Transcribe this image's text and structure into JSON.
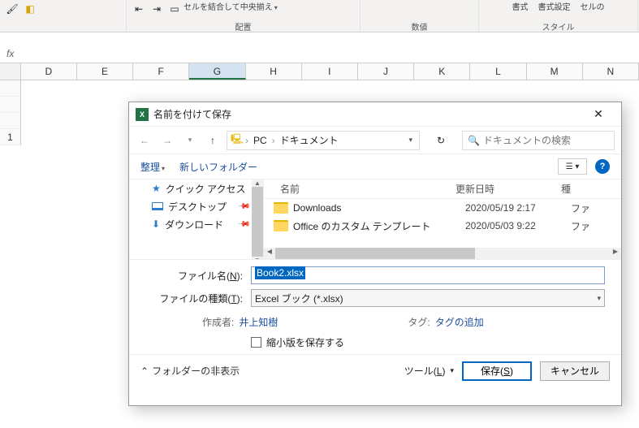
{
  "ribbon": {
    "merge_center": "セルを結合して中央揃え",
    "group_alignment": "配置",
    "group_number": "数値",
    "group_styles": "スタイル",
    "cond_fmt": "書式",
    "fmt_table": "書式設定",
    "cell_styles": "セルの"
  },
  "fx": {
    "label": "fx"
  },
  "columns": [
    "D",
    "E",
    "F",
    "G",
    "H",
    "I",
    "J",
    "K",
    "L",
    "M",
    "N"
  ],
  "rownum": "1",
  "dialog": {
    "title": "名前を付けて保存",
    "breadcrumb": {
      "root": "PC",
      "folder": "ドキュメント"
    },
    "search_placeholder": "ドキュメントの検索",
    "organize": "整理",
    "new_folder": "新しいフォルダー",
    "nav": {
      "quick_access": "クイック アクセス",
      "desktop": "デスクトップ",
      "downloads": "ダウンロード"
    },
    "list": {
      "col_name": "名前",
      "col_date": "更新日時",
      "col_type": "種",
      "rows": [
        {
          "name": "Downloads",
          "date": "2020/05/19 2:17",
          "type": "ファ"
        },
        {
          "name": "Office のカスタム テンプレート",
          "date": "2020/05/03 9:22",
          "type": "ファ"
        }
      ]
    },
    "filename_label": "ファイル名(N):",
    "filename_value": "Book2.xlsx",
    "filetype_label": "ファイルの種類(T):",
    "filetype_value": "Excel ブック (*.xlsx)",
    "author_label": "作成者:",
    "author_value": "井上知樹",
    "tags_label": "タグ:",
    "tags_value": "タグの追加",
    "thumbnail_label": "縮小版を保存する",
    "hide_folders": "フォルダーの非表示",
    "tools": "ツール(L)",
    "save": "保存(S)",
    "cancel": "キャンセル"
  }
}
